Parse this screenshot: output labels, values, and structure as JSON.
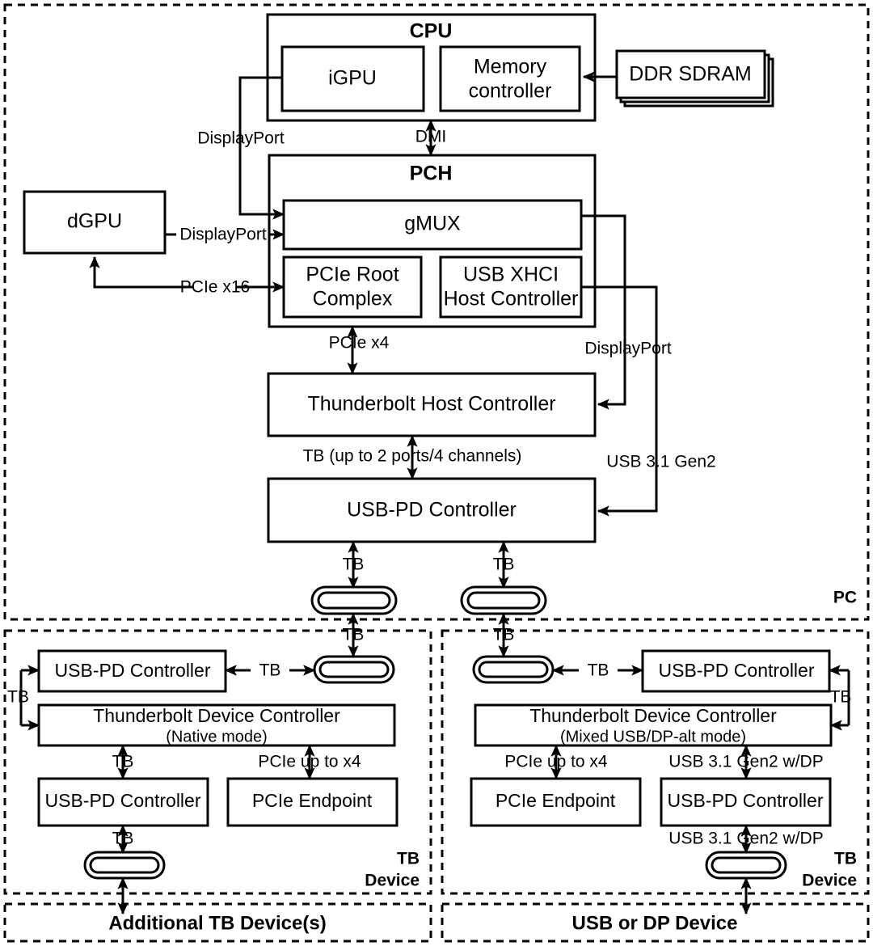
{
  "diagram": {
    "title": "Thunderbolt / USB-C system block diagram",
    "colors": {
      "line": "#000000",
      "fill": "#ffffff"
    }
  },
  "zones": {
    "pc": {
      "label": "PC"
    },
    "tb_device_left": {
      "label_line1": "TB",
      "label_line2": "Device"
    },
    "tb_device_right": {
      "label_line1": "TB",
      "label_line2": "Device"
    },
    "additional_tb": {
      "label": "Additional TB Device(s)"
    },
    "usb_dp_device": {
      "label": "USB or DP Device"
    }
  },
  "pc": {
    "cpu": {
      "title": "CPU",
      "igpu": "iGPU",
      "memory_controller_line1": "Memory",
      "memory_controller_line2": "controller"
    },
    "ddr": "DDR SDRAM",
    "dgpu": "dGPU",
    "pch": {
      "title": "PCH",
      "gmux": "gMUX",
      "pcie_root_line1": "PCIe Root",
      "pcie_root_line2": "Complex",
      "xhci_line1": "USB XHCI",
      "xhci_line2": "Host Controller"
    },
    "tb_host_controller": "Thunderbolt Host Controller",
    "usb_pd_controller": "USB-PD Controller",
    "links": {
      "dmi": "DMI",
      "dp_igpu": "DisplayPort",
      "dp_dgpu": "DisplayPort",
      "pcie_x16": "PCIe x16",
      "pcie_x4": "PCIe x4",
      "dp_gmux": "DisplayPort",
      "usb31_gen2": "USB 3.1 Gen2",
      "tb_ports": "TB (up to 2 ports/4 channels)",
      "tb_port_left": "TB",
      "tb_port_right": "TB"
    },
    "ports": {
      "left": "usb-c-port",
      "right": "usb-c-port"
    }
  },
  "tb_device_left": {
    "usb_pd_top": "USB-PD Controller",
    "tb_device_controller": "Thunderbolt Device Controller",
    "tb_device_controller_mode": "(Native mode)",
    "usb_pd_bottom": "USB-PD Controller",
    "pcie_endpoint": "PCIe Endpoint",
    "links": {
      "tb_in_port": "TB",
      "tb_side": "TB",
      "tb_pd_port": "TB",
      "tb_down": "TB",
      "pcie_up_to_x4": "PCIe up to x4",
      "tb_bottom": "TB"
    }
  },
  "tb_device_right": {
    "usb_pd_top": "USB-PD Controller",
    "tb_device_controller": "Thunderbolt Device Controller",
    "tb_device_controller_mode": "(Mixed USB/DP-alt mode)",
    "usb_pd_bottom": "USB-PD Controller",
    "pcie_endpoint": "PCIe Endpoint",
    "links": {
      "tb_in_port": "TB",
      "tb_side": "TB",
      "tb_pd_port": "TB",
      "pcie_up_to_x4": "PCIe up to x4",
      "usb_dp_upper": "USB 3.1 Gen2 w/DP",
      "usb_dp_lower": "USB 3.1 Gen2 w/DP"
    }
  }
}
